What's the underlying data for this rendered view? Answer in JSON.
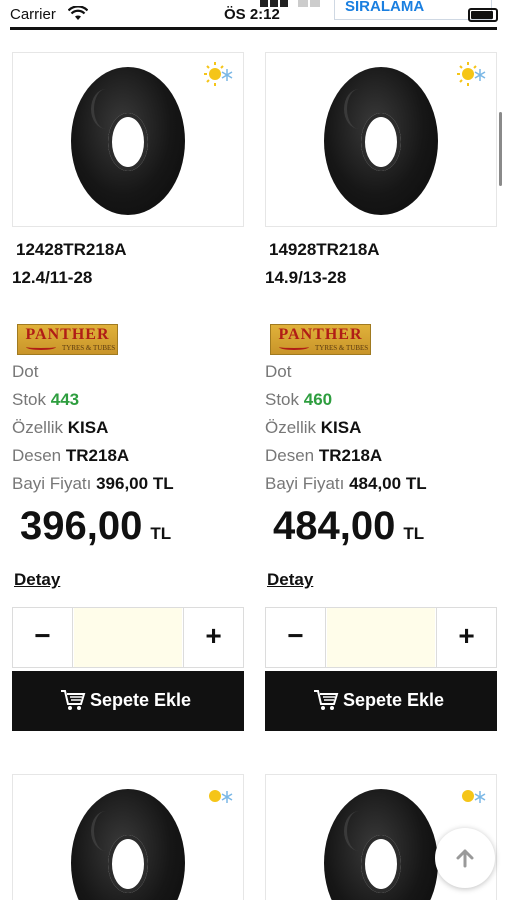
{
  "status_bar": {
    "carrier": "Carrier",
    "time": "ÖS 2:12",
    "sort_label": "SIRALAMA"
  },
  "products": [
    {
      "code": "12428TR218A",
      "size": "12.4/11-28",
      "brand": "PANTHER",
      "brand_sub": "TYRES & TUBES",
      "dot_label": "Dot",
      "stok_label": "Stok",
      "stok_value": "443",
      "ozellik_label": "Özellik",
      "ozellik_value": "KISA",
      "desen_label": "Desen",
      "desen_value": "TR218A",
      "fiyat_label": "Bayi Fiyatı",
      "fiyat_value": "396,00 TL",
      "price": "396,00",
      "currency": "TL",
      "detail_label": "Detay",
      "minus": "−",
      "plus": "+",
      "quantity": "",
      "add_to_cart": "Sepete Ekle"
    },
    {
      "code": "14928TR218A",
      "size": "14.9/13-28",
      "brand": "PANTHER",
      "brand_sub": "TYRES & TUBES",
      "dot_label": "Dot",
      "stok_label": "Stok",
      "stok_value": "460",
      "ozellik_label": "Özellik",
      "ozellik_value": "KISA",
      "desen_label": "Desen",
      "desen_value": "TR218A",
      "fiyat_label": "Bayi Fiyatı",
      "fiyat_value": "484,00 TL",
      "price": "484,00",
      "currency": "TL",
      "detail_label": "Detay",
      "minus": "−",
      "plus": "+",
      "quantity": "",
      "add_to_cart": "Sepete Ekle"
    }
  ],
  "icons": {
    "season": "sun-snow-icon",
    "cart": "cart-icon",
    "scroll_top": "arrow-up-icon",
    "wifi": "wifi-icon",
    "battery": "battery-icon"
  },
  "colors": {
    "stock_green": "#2e9e3f",
    "sort_blue": "#1a7fe0",
    "button_black": "#111111",
    "qty_bg": "#fffdea"
  }
}
